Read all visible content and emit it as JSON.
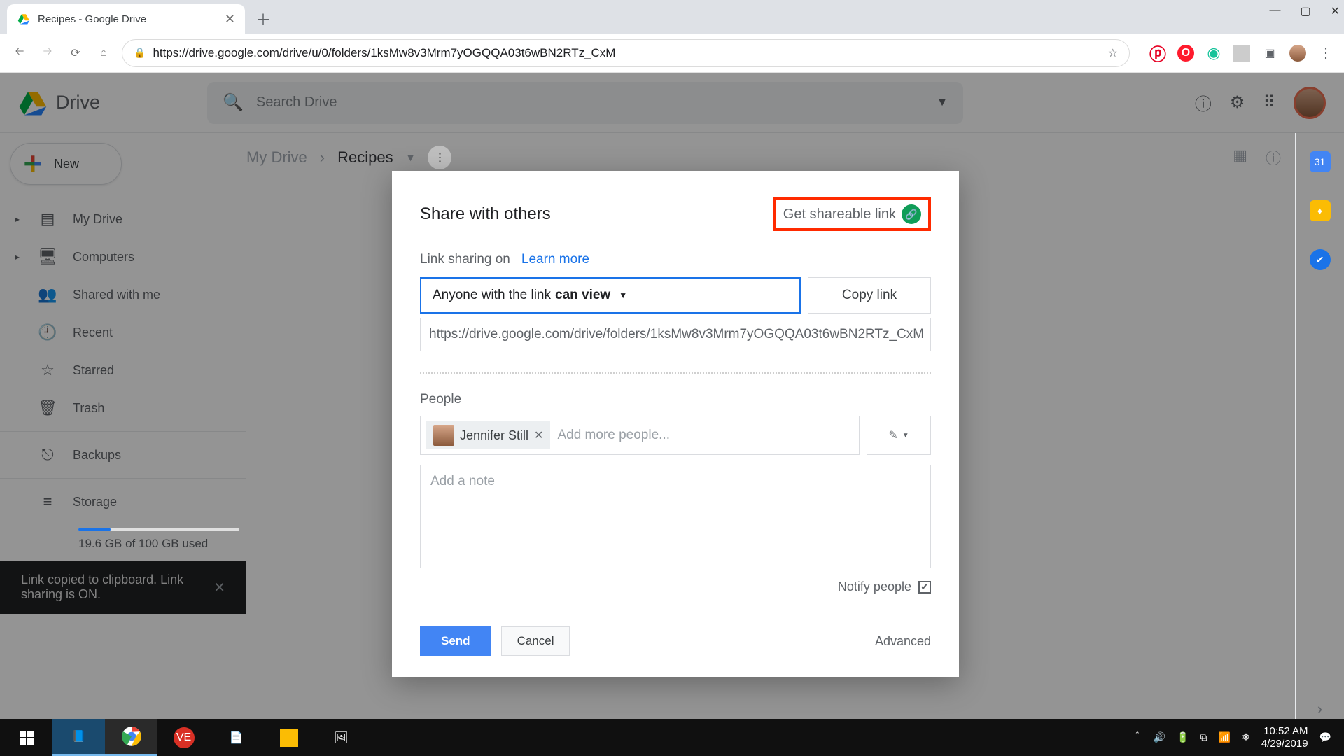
{
  "browser": {
    "tab_title": "Recipes - Google Drive",
    "url": "https://drive.google.com/drive/u/0/folders/1ksMw8v3Mrm7yOGQQA03t6wBN2RTz_CxM"
  },
  "drive": {
    "brand": "Drive",
    "search_placeholder": "Search Drive",
    "new_button": "New",
    "nav": {
      "my_drive": "My Drive",
      "computers": "Computers",
      "shared": "Shared with me",
      "recent": "Recent",
      "starred": "Starred",
      "trash": "Trash",
      "backups": "Backups",
      "storage": "Storage",
      "storage_used": "19.6 GB of 100 GB used"
    },
    "breadcrumb": {
      "root": "My Drive",
      "current": "Recipes"
    },
    "toast": "Link copied to clipboard. Link sharing is ON."
  },
  "share": {
    "title": "Share with others",
    "get_link": "Get shareable link",
    "sharing_on": "Link sharing on",
    "learn_more": "Learn more",
    "permission_prefix": "Anyone with the link ",
    "permission_level": "can view",
    "copy_link": "Copy link",
    "share_url": "https://drive.google.com/drive/folders/1ksMw8v3Mrm7yOGQQA03t6wBN2RTz_CxM",
    "people_label": "People",
    "chip_name": "Jennifer Still",
    "people_placeholder": "Add more people...",
    "note_placeholder": "Add a note",
    "notify": "Notify people",
    "send": "Send",
    "cancel": "Cancel",
    "advanced": "Advanced"
  },
  "taskbar": {
    "time": "10:52 AM",
    "date": "4/29/2019"
  }
}
